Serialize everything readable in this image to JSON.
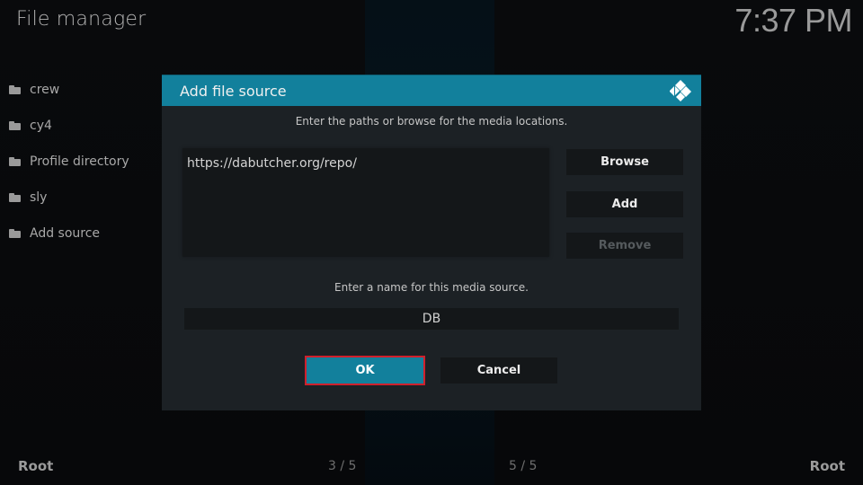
{
  "header": {
    "title": "File manager",
    "clock": "7:37 PM"
  },
  "sidebar": {
    "items": [
      {
        "label": "crew",
        "icon": "folder-icon"
      },
      {
        "label": "cy4",
        "icon": "folder-icon"
      },
      {
        "label": "Profile directory",
        "icon": "folder-icon"
      },
      {
        "label": "sly",
        "icon": "folder-icon"
      },
      {
        "label": "Add source",
        "icon": "folder-icon"
      }
    ]
  },
  "dialog": {
    "title": "Add file source",
    "logo": "kodi-logo-icon",
    "paths_hint": "Enter the paths or browse for the media locations.",
    "paths": [
      "https://dabutcher.org/repo/"
    ],
    "buttons": {
      "browse": "Browse",
      "add": "Add",
      "remove": "Remove"
    },
    "name_hint": "Enter a name for this media source.",
    "name_value": "DB",
    "ok": "OK",
    "cancel": "Cancel"
  },
  "footer": {
    "left_label": "Root",
    "left_count": "3 / 5",
    "right_count": "5 / 5",
    "right_label": "Root"
  },
  "colors": {
    "accent": "#12809c",
    "focus_border": "#d0202c",
    "dialog_bg": "#1c2125"
  }
}
